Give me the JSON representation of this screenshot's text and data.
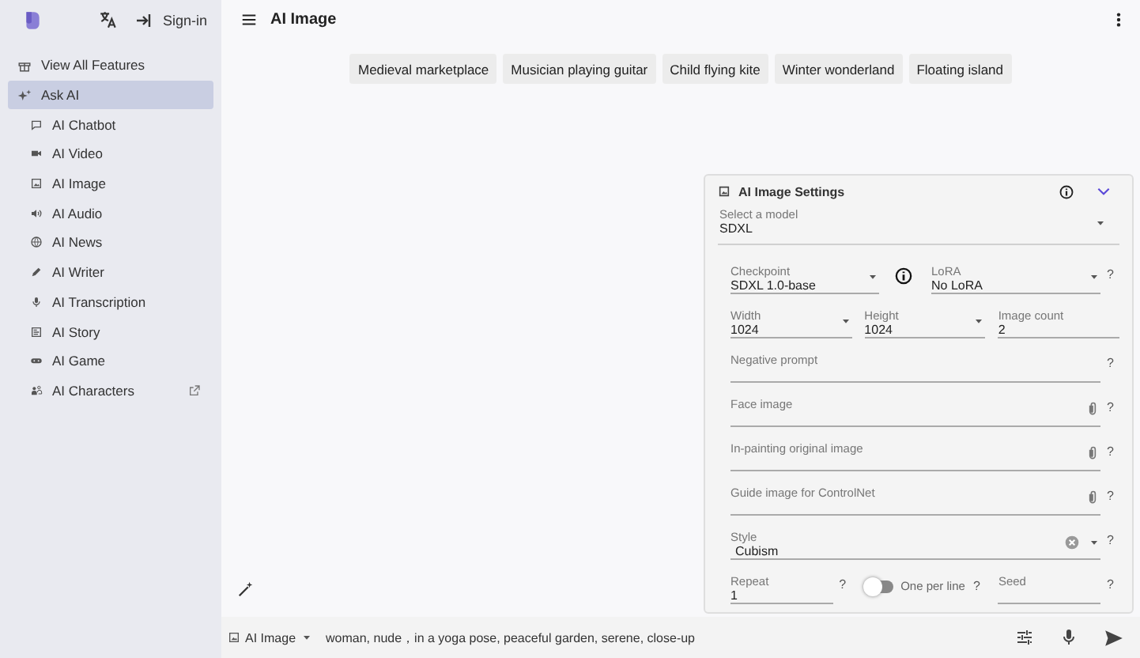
{
  "sidebar": {
    "sign_in": "Sign-in",
    "items": [
      {
        "label": "View All Features",
        "selected": false
      },
      {
        "label": "Ask AI",
        "selected": true,
        "children": [
          {
            "label": "AI Chatbot",
            "selected": false,
            "external": false
          },
          {
            "label": "AI Video",
            "selected": false,
            "external": false
          },
          {
            "label": "AI Image",
            "selected": false,
            "external": false
          },
          {
            "label": "AI Audio",
            "selected": false,
            "external": false
          },
          {
            "label": "AI News",
            "selected": false,
            "external": false
          },
          {
            "label": "AI Writer",
            "selected": false,
            "external": false
          },
          {
            "label": "AI Transcription",
            "selected": false,
            "external": false
          },
          {
            "label": "AI Story",
            "selected": false,
            "external": false
          },
          {
            "label": "AI Game",
            "selected": false,
            "external": false
          },
          {
            "label": "AI Characters",
            "selected": false,
            "external": true
          }
        ]
      }
    ]
  },
  "header": {
    "title": "AI Image"
  },
  "suggestions": [
    "Medieval marketplace",
    "Musician playing guitar",
    "Child flying kite",
    "Winter wonderland",
    "Floating island"
  ],
  "settings": {
    "title": "AI Image Settings",
    "expanded": true,
    "model": {
      "label": "Select a model",
      "value": "SDXL"
    },
    "rows": [
      {
        "fields": [
          {
            "kind": "select",
            "label": "Checkpoint",
            "value": "SDXL 1.0-base",
            "info": true
          },
          {
            "kind": "select",
            "label": "LoRA",
            "value": "No LoRA",
            "help": "?"
          }
        ]
      },
      {
        "fields": [
          {
            "kind": "select",
            "label": "Width",
            "value": "1024"
          },
          {
            "kind": "select",
            "label": "Height",
            "value": "1024"
          },
          {
            "kind": "text",
            "label": "Image count",
            "value": "2"
          }
        ]
      },
      {
        "fields": [
          {
            "kind": "text",
            "label": "Negative prompt",
            "help": "?"
          }
        ]
      },
      {
        "fields": [
          {
            "kind": "file",
            "label": "Face image",
            "help": "?"
          }
        ]
      },
      {
        "fields": [
          {
            "kind": "file",
            "label": "In-painting original image",
            "help": "?"
          }
        ]
      },
      {
        "fields": [
          {
            "kind": "file",
            "label": "Guide image for ControlNet",
            "help": "?"
          }
        ]
      },
      {
        "fields": [
          {
            "kind": "select",
            "label": "Style",
            "value": "Cubism",
            "clearable": true,
            "help": "?"
          }
        ]
      },
      {
        "fields": [
          {
            "kind": "text",
            "label": "Repeat",
            "value": "1",
            "help": "?"
          },
          {
            "kind": "toggle",
            "label": "One per line",
            "on": false,
            "help": "?"
          },
          {
            "kind": "text",
            "label": "Seed",
            "help": "?"
          }
        ]
      }
    ]
  },
  "composer": {
    "mode": "AI Image",
    "prompt": "woman, nude，in a yoga pose, peaceful garden, serene, close-up"
  }
}
